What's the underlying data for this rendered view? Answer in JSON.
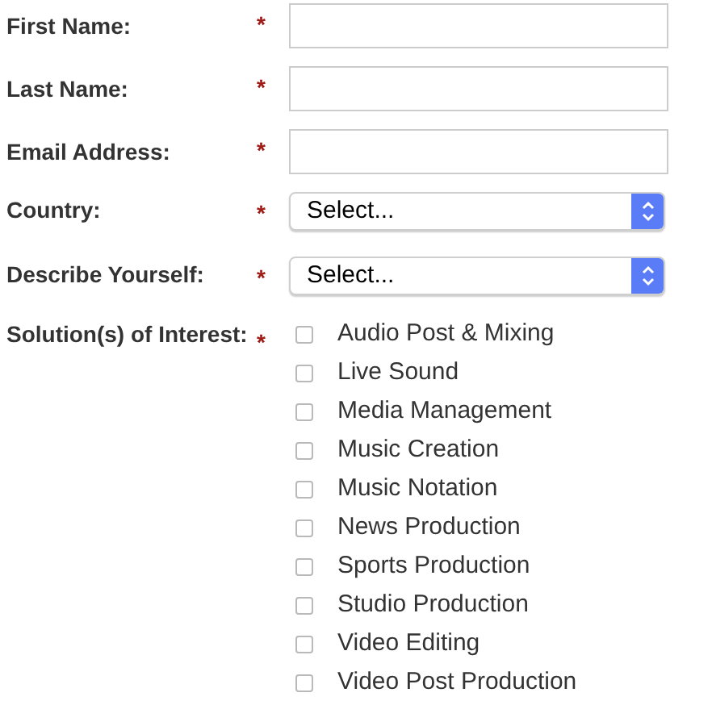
{
  "fields": [
    {
      "kind": "text",
      "label": "First Name:",
      "required_mark": "*"
    },
    {
      "kind": "text",
      "label": "Last Name:",
      "required_mark": "*"
    },
    {
      "kind": "text",
      "label": "Email Address:",
      "required_mark": "*"
    },
    {
      "kind": "select",
      "label": "Country:",
      "required_mark": "*",
      "value": "Select..."
    },
    {
      "kind": "select",
      "label": "Describe Yourself:",
      "required_mark": "*",
      "value": "Select..."
    },
    {
      "kind": "checkboxes",
      "label": "Solution(s) of Interest:",
      "required_mark": "*",
      "options": [
        {
          "label": "Audio Post & Mixing",
          "checked": false
        },
        {
          "label": "Live Sound",
          "checked": false
        },
        {
          "label": "Media Management",
          "checked": false
        },
        {
          "label": "Music Creation",
          "checked": false
        },
        {
          "label": "Music Notation",
          "checked": false
        },
        {
          "label": "News Production",
          "checked": false
        },
        {
          "label": "Sports Production",
          "checked": false
        },
        {
          "label": "Studio Production",
          "checked": false
        },
        {
          "label": "Video Editing",
          "checked": false
        },
        {
          "label": "Video Post Production",
          "checked": false
        }
      ]
    }
  ]
}
